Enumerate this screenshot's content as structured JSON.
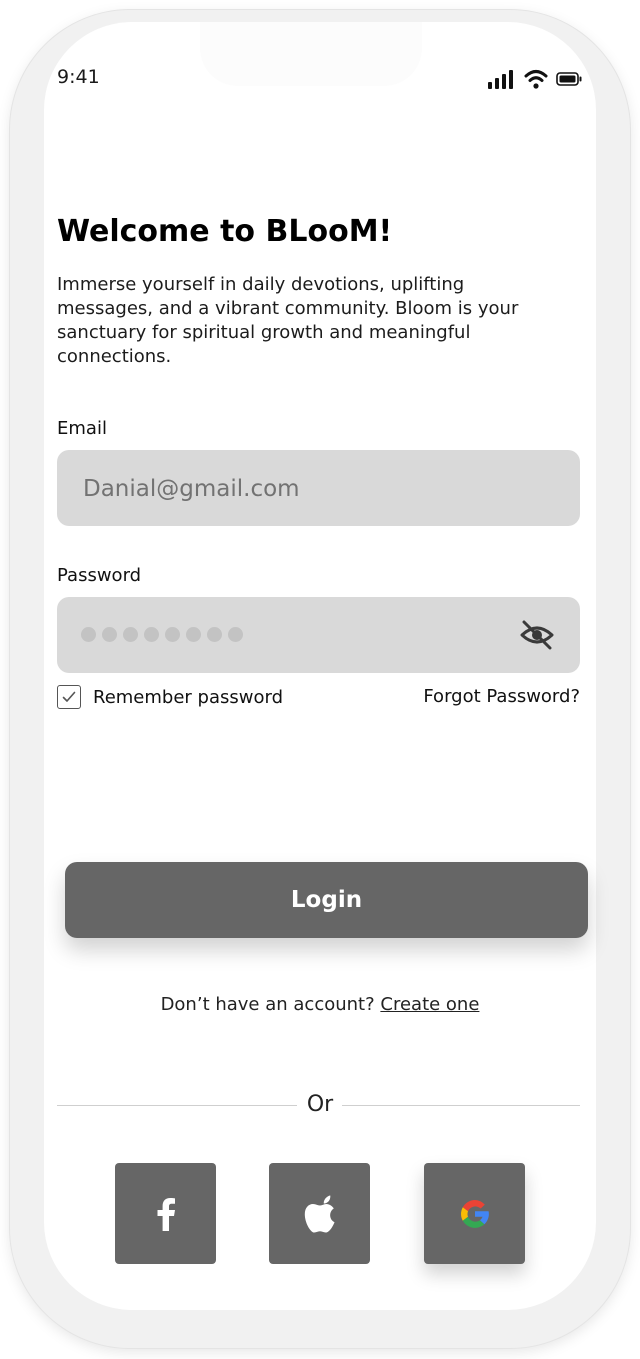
{
  "status_bar": {
    "time": "9:41"
  },
  "welcome": {
    "title": "Welcome to BLooM!",
    "description": "Immerse yourself in daily devotions, uplifting messages, and a vibrant community. Bloom is your sanctuary for spiritual growth and meaningful connections."
  },
  "form": {
    "email_label": "Email",
    "email_placeholder": "Danial@gmail.com",
    "password_label": "Password",
    "password_masked_length": 8,
    "remember_label": "Remember password",
    "remember_checked": true,
    "forgot_label": "Forgot Password?"
  },
  "login_label": "Login",
  "signup": {
    "prompt": "Don’t have an account?",
    "link": "Create one"
  },
  "divider_text": "Or",
  "social_buttons": [
    {
      "name": "facebook",
      "icon": "facebook-icon"
    },
    {
      "name": "apple",
      "icon": "apple-icon"
    },
    {
      "name": "google",
      "icon": "google-icon"
    }
  ],
  "colors": {
    "button": "#666666",
    "input_bg": "#d9d9d9",
    "placeholder": "#727272",
    "google_blue": "#4285F4",
    "google_red": "#EA4335",
    "google_yellow": "#FBBC05",
    "google_green": "#34A853"
  }
}
